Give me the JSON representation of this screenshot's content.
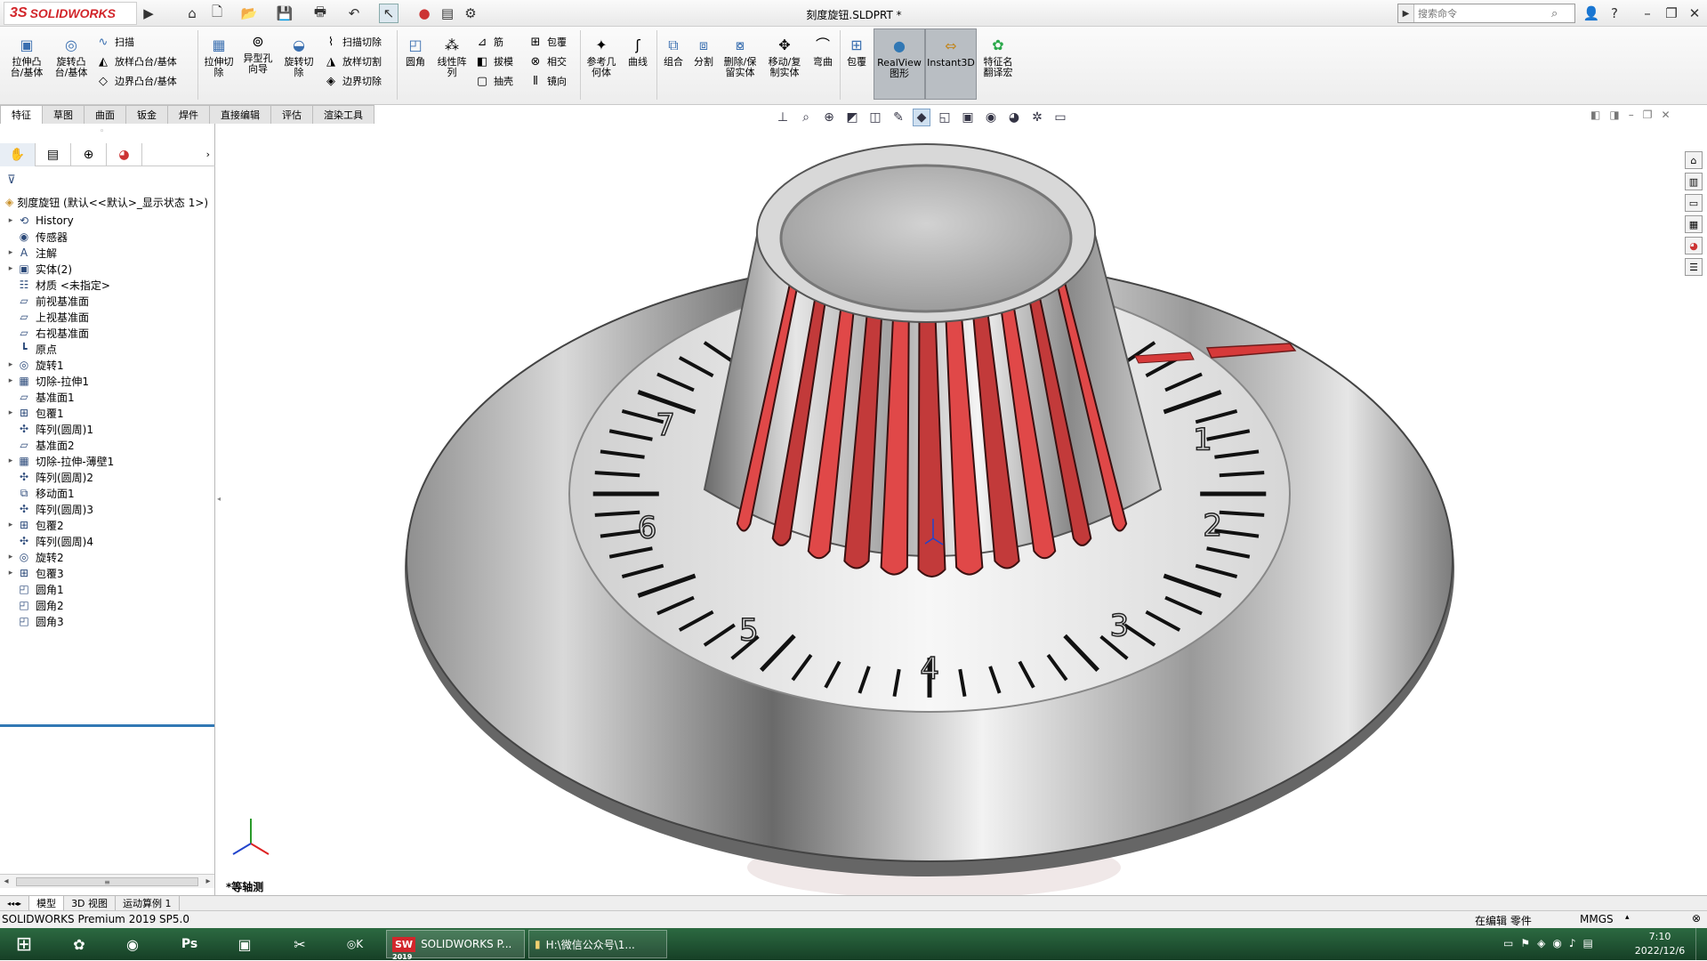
{
  "app": {
    "logo_mark": "3S",
    "logo_text": "SOLIDWORKS",
    "doc_title": "刻度旋钮.SLDPRT *"
  },
  "search": {
    "placeholder": "搜索命令"
  },
  "toolbar": {
    "extrude_boss": "拉伸凸\n台/基体",
    "revolve_boss": "旋转凸\n台/基体",
    "sweep": "扫描",
    "loft_boss": "放样凸台/基体",
    "boundary_boss": "边界凸台/基体",
    "extrude_cut": "拉伸切\n除",
    "hole_wizard": "异型孔\n向导",
    "revolve_cut": "旋转切\n除",
    "swept_cut": "扫描切除",
    "lofted_cut": "放样切割",
    "boundary_cut": "边界切除",
    "fillet": "圆角",
    "linear_pattern": "线性阵\n列",
    "rib": "筋",
    "draft": "拔模",
    "shell": "抽壳",
    "wrap": "包覆",
    "intersect": "相交",
    "mirror": "镜向",
    "ref_geometry": "参考几\n何体",
    "curves": "曲线",
    "combine": "组合",
    "split": "分割",
    "delete_keep": "删除/保\n留实体",
    "move_copy": "移动/复\n制实体",
    "flex": "弯曲",
    "wrap2": "包覆",
    "realview": "RealView\n图形",
    "instant3d": "Instant3D",
    "feature_translate": "特征名\n翻译宏"
  },
  "tabs": [
    {
      "label": "特征",
      "active": true
    },
    {
      "label": "草图"
    },
    {
      "label": "曲面"
    },
    {
      "label": "钣金"
    },
    {
      "label": "焊件"
    },
    {
      "label": "直接编辑"
    },
    {
      "label": "评估"
    },
    {
      "label": "渲染工具"
    }
  ],
  "tree": {
    "root": "刻度旋钮 (默认<<默认>_显示状态 1>)",
    "items": [
      {
        "label": "History",
        "icon": "history-icon",
        "exp": true
      },
      {
        "label": "传感器",
        "icon": "sensor-icon",
        "exp": false
      },
      {
        "label": "注解",
        "icon": "annotation-icon",
        "exp": true
      },
      {
        "label": "实体(2)",
        "icon": "solid-bodies-icon",
        "exp": true
      },
      {
        "label": "材质 <未指定>",
        "icon": "material-icon",
        "exp": false
      },
      {
        "label": "前视基准面",
        "icon": "plane-icon",
        "exp": false
      },
      {
        "label": "上视基准面",
        "icon": "plane-icon",
        "exp": false
      },
      {
        "label": "右视基准面",
        "icon": "plane-icon",
        "exp": false
      },
      {
        "label": "原点",
        "icon": "origin-icon",
        "exp": false
      },
      {
        "label": "旋转1",
        "icon": "revolve-icon",
        "exp": true
      },
      {
        "label": "切除-拉伸1",
        "icon": "cut-extrude-icon",
        "exp": true
      },
      {
        "label": "基准面1",
        "icon": "plane-icon",
        "exp": false
      },
      {
        "label": "包覆1",
        "icon": "wrap-icon",
        "exp": true
      },
      {
        "label": "阵列(圆周)1",
        "icon": "circular-pattern-icon",
        "exp": false
      },
      {
        "label": "基准面2",
        "icon": "plane-icon",
        "exp": false
      },
      {
        "label": "切除-拉伸-薄壁1",
        "icon": "cut-extrude-icon",
        "exp": true
      },
      {
        "label": "阵列(圆周)2",
        "icon": "circular-pattern-icon",
        "exp": false
      },
      {
        "label": "移动面1",
        "icon": "move-face-icon",
        "exp": false
      },
      {
        "label": "阵列(圆周)3",
        "icon": "circular-pattern-icon",
        "exp": false
      },
      {
        "label": "包覆2",
        "icon": "wrap-icon",
        "exp": true
      },
      {
        "label": "阵列(圆周)4",
        "icon": "circular-pattern-icon",
        "exp": false
      },
      {
        "label": "旋转2",
        "icon": "revolve-icon",
        "exp": true
      },
      {
        "label": "包覆3",
        "icon": "wrap-icon",
        "exp": true
      },
      {
        "label": "圆角1",
        "icon": "fillet-icon",
        "exp": false
      },
      {
        "label": "圆角2",
        "icon": "fillet-icon",
        "exp": false
      },
      {
        "label": "圆角3",
        "icon": "fillet-icon",
        "exp": false
      }
    ]
  },
  "viewport": {
    "view_label": "*等轴测",
    "dial_numbers": [
      "1",
      "2",
      "3",
      "4",
      "5",
      "6",
      "7"
    ]
  },
  "bottom_tabs": [
    {
      "label": "模型",
      "active": true
    },
    {
      "label": "3D 视图"
    },
    {
      "label": "运动算例 1"
    }
  ],
  "status": {
    "product": "SOLIDWORKS Premium 2019 SP5.0",
    "mode": "在编辑 零件",
    "units": "MMGS"
  },
  "taskbar": {
    "app_label": "SOLIDWORKS P...",
    "app_badge": "2019",
    "folder_label": "H:\\微信公众号\\1...",
    "time": "7:10",
    "date": "2022/12/6"
  },
  "colors": {
    "accent_red": "#d2262b",
    "highlight": "#3278b4",
    "taskbar": "#1f5131"
  }
}
